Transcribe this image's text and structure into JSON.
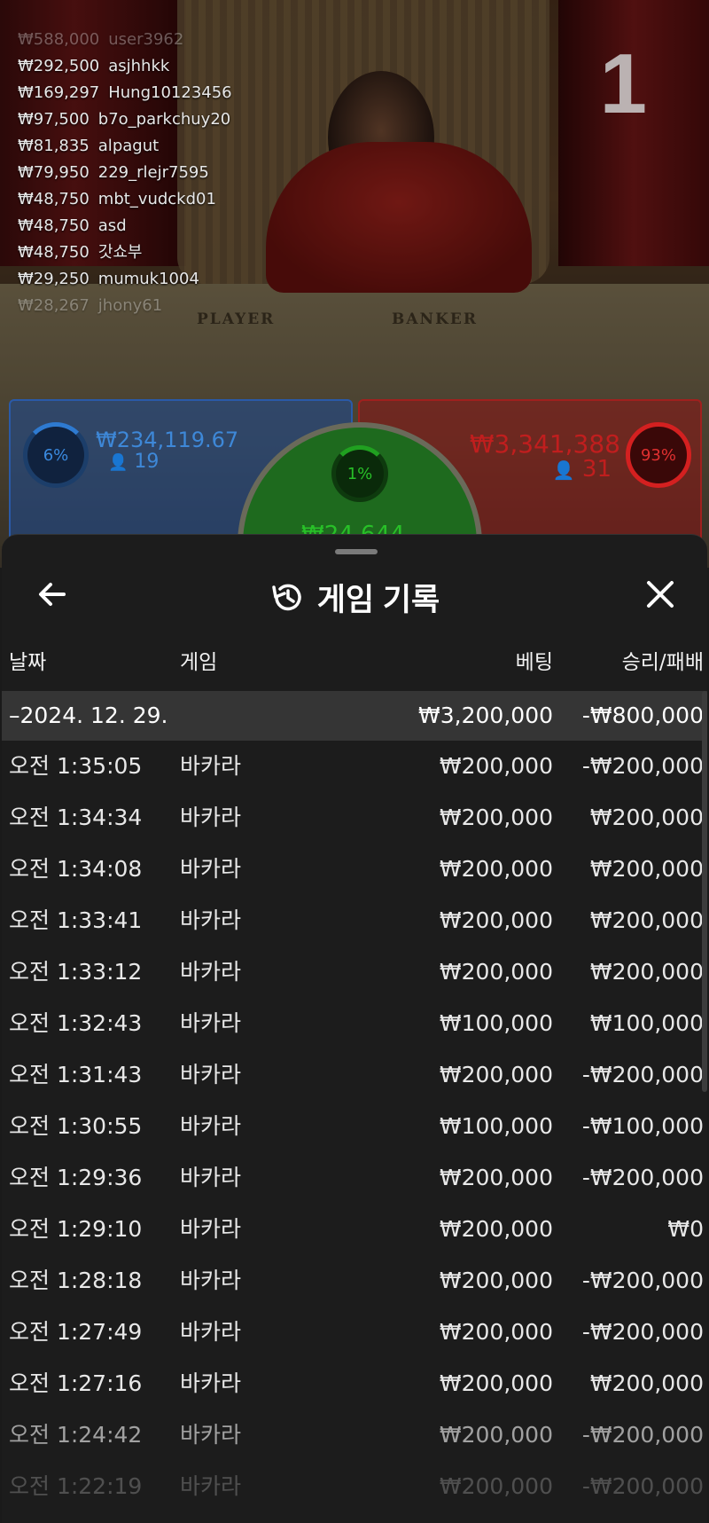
{
  "game": {
    "round_number": "1",
    "table_labels": {
      "player": "PLAYER",
      "banker": "BANKER"
    },
    "bet_feed": [
      {
        "amount": "₩588,000",
        "user": "user3962",
        "faded": true
      },
      {
        "amount": "₩292,500",
        "user": "asjhhkk"
      },
      {
        "amount": "₩169,297",
        "user": "Hung10123456"
      },
      {
        "amount": "₩97,500",
        "user": "b7o_parkchuy20"
      },
      {
        "amount": "₩81,835",
        "user": "alpagut"
      },
      {
        "amount": "₩79,950",
        "user": "229_rlejr7595"
      },
      {
        "amount": "₩48,750",
        "user": "mbt_vudckd01"
      },
      {
        "amount": "₩48,750",
        "user": "asd"
      },
      {
        "amount": "₩48,750",
        "user": "갓쇼부"
      },
      {
        "amount": "₩29,250",
        "user": "mumuk1004"
      },
      {
        "amount": "₩28,267",
        "user": "jhony61",
        "faded": true
      }
    ],
    "player_bet": {
      "percent": "6%",
      "amount": "₩234,119.67",
      "players": "19",
      "color": "#2e7ad0"
    },
    "banker_bet": {
      "percent": "93%",
      "amount": "₩3,341,388",
      "players": "31",
      "color": "#d42020"
    },
    "tie_bet": {
      "percent": "1%",
      "amount": "₩24,644",
      "color": "#20a020"
    }
  },
  "history": {
    "title": "게임 기록",
    "back_icon": "arrow-left-icon",
    "history_icon": "history-clock-icon",
    "close_icon": "close-x-icon",
    "columns": {
      "date": "날짜",
      "game": "게임",
      "bet": "베팅",
      "result": "승리/패배"
    },
    "date_group": {
      "expand_symbol": "–",
      "date": "2024. 12. 29.",
      "total_bet": "₩3,200,000",
      "total_result": "-₩800,000"
    },
    "rows": [
      {
        "time": "오전 1:35:05",
        "game": "바카라",
        "bet": "₩200,000",
        "result": "-₩200,000"
      },
      {
        "time": "오전 1:34:34",
        "game": "바카라",
        "bet": "₩200,000",
        "result": "₩200,000"
      },
      {
        "time": "오전 1:34:08",
        "game": "바카라",
        "bet": "₩200,000",
        "result": "₩200,000"
      },
      {
        "time": "오전 1:33:41",
        "game": "바카라",
        "bet": "₩200,000",
        "result": "₩200,000"
      },
      {
        "time": "오전 1:33:12",
        "game": "바카라",
        "bet": "₩200,000",
        "result": "₩200,000"
      },
      {
        "time": "오전 1:32:43",
        "game": "바카라",
        "bet": "₩100,000",
        "result": "₩100,000"
      },
      {
        "time": "오전 1:31:43",
        "game": "바카라",
        "bet": "₩200,000",
        "result": "-₩200,000"
      },
      {
        "time": "오전 1:30:55",
        "game": "바카라",
        "bet": "₩100,000",
        "result": "-₩100,000"
      },
      {
        "time": "오전 1:29:36",
        "game": "바카라",
        "bet": "₩200,000",
        "result": "-₩200,000"
      },
      {
        "time": "오전 1:29:10",
        "game": "바카라",
        "bet": "₩200,000",
        "result": "₩0"
      },
      {
        "time": "오전 1:28:18",
        "game": "바카라",
        "bet": "₩200,000",
        "result": "-₩200,000"
      },
      {
        "time": "오전 1:27:49",
        "game": "바카라",
        "bet": "₩200,000",
        "result": "-₩200,000"
      },
      {
        "time": "오전 1:27:16",
        "game": "바카라",
        "bet": "₩200,000",
        "result": "₩200,000"
      },
      {
        "time": "오전 1:24:42",
        "game": "바카라",
        "bet": "₩200,000",
        "result": "-₩200,000"
      },
      {
        "time": "오전 1:22:19",
        "game": "바카라",
        "bet": "₩200,000",
        "result": "-₩200,000"
      }
    ]
  }
}
